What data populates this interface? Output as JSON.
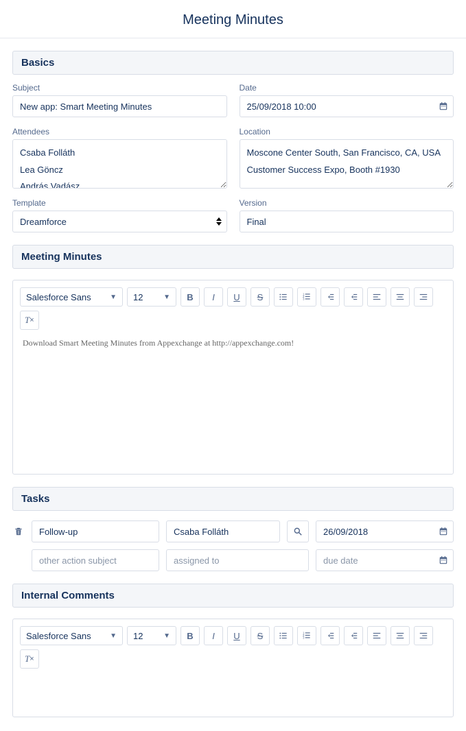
{
  "pageTitle": "Meeting Minutes",
  "sections": {
    "basics": {
      "header": "Basics"
    },
    "minutes": {
      "header": "Meeting Minutes"
    },
    "tasks": {
      "header": "Tasks"
    },
    "comments": {
      "header": "Internal Comments"
    }
  },
  "basics": {
    "subjectLabel": "Subject",
    "subjectValue": "New app: Smart Meeting Minutes",
    "dateLabel": "Date",
    "dateValue": "25/09/2018 10:00",
    "attendeesLabel": "Attendees",
    "attendeesValue": "Csaba Folláth\nLea Göncz\nAndrás Vadász",
    "locationLabel": "Location",
    "locationValue": "Moscone Center South, San Francisco, CA, USA\nCustomer Success Expo, Booth #1930",
    "templateLabel": "Template",
    "templateValue": "Dreamforce",
    "versionLabel": "Version",
    "versionValue": "Final"
  },
  "rte": {
    "font": "Salesforce Sans",
    "size": "12",
    "body": "Download Smart Meeting Minutes from Appexchange at http://appexchange.com!"
  },
  "tasks": {
    "row1": {
      "subject": "Follow-up",
      "assigned": "Csaba Folláth",
      "date": "26/09/2018"
    },
    "placeholders": {
      "subject": "other action subject",
      "assigned": "assigned to",
      "date": "due date"
    }
  },
  "comments": {
    "font": "Salesforce Sans",
    "size": "12",
    "body": ""
  }
}
